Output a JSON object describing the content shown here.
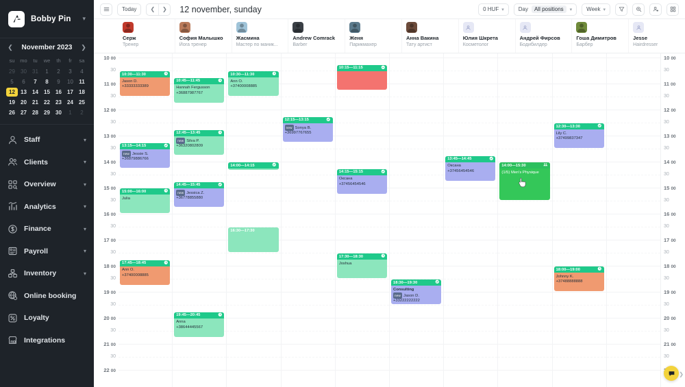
{
  "sidebar": {
    "brand": {
      "name": "Bobby Pin",
      "logo_icon": "bobbypin-logo-icon",
      "caret_icon": "chevron-down-icon"
    },
    "calendar": {
      "title": "November 2023",
      "prev_icon": "chevron-left-icon",
      "next_icon": "chevron-right-icon",
      "dow": [
        "su",
        "mo",
        "tu",
        "we",
        "th",
        "fr",
        "sa"
      ],
      "selected_day": "12",
      "weeks": [
        [
          {
            "d": "29",
            "t": "muted"
          },
          {
            "d": "30",
            "t": "muted"
          },
          {
            "d": "31",
            "t": "muted"
          },
          {
            "d": "1",
            "t": "dim"
          },
          {
            "d": "2",
            "t": "dim"
          },
          {
            "d": "3",
            "t": "dim"
          },
          {
            "d": "4",
            "t": "dim"
          }
        ],
        [
          {
            "d": "5",
            "t": "dim"
          },
          {
            "d": "6",
            "t": "dim"
          },
          {
            "d": "7",
            "t": "on"
          },
          {
            "d": "8",
            "t": "on"
          },
          {
            "d": "9",
            "t": "dim"
          },
          {
            "d": "10",
            "t": "dim"
          },
          {
            "d": "11",
            "t": "on"
          }
        ],
        [
          {
            "d": "12",
            "t": "sel"
          },
          {
            "d": "13",
            "t": "on"
          },
          {
            "d": "14",
            "t": "on"
          },
          {
            "d": "15",
            "t": "on"
          },
          {
            "d": "16",
            "t": "on"
          },
          {
            "d": "17",
            "t": "on"
          },
          {
            "d": "18",
            "t": "on"
          }
        ],
        [
          {
            "d": "19",
            "t": "on"
          },
          {
            "d": "20",
            "t": "on"
          },
          {
            "d": "21",
            "t": "on"
          },
          {
            "d": "22",
            "t": "on"
          },
          {
            "d": "23",
            "t": "on"
          },
          {
            "d": "24",
            "t": "on"
          },
          {
            "d": "25",
            "t": "on"
          }
        ],
        [
          {
            "d": "26",
            "t": "on"
          },
          {
            "d": "27",
            "t": "on"
          },
          {
            "d": "28",
            "t": "on"
          },
          {
            "d": "29",
            "t": "on"
          },
          {
            "d": "30",
            "t": "on"
          },
          {
            "d": "1",
            "t": "muted"
          },
          {
            "d": "2",
            "t": "muted"
          }
        ]
      ]
    },
    "items": [
      {
        "label": "Staff",
        "icon": "user-icon",
        "expandable": true
      },
      {
        "label": "Clients",
        "icon": "users-icon",
        "expandable": true
      },
      {
        "label": "Overview",
        "icon": "grid-search-icon",
        "expandable": true
      },
      {
        "label": "Analytics",
        "icon": "bar-chart-icon",
        "expandable": true
      },
      {
        "label": "Finance",
        "icon": "dollar-coin-icon",
        "expandable": true
      },
      {
        "label": "Payroll",
        "icon": "payroll-icon",
        "expandable": true
      },
      {
        "label": "Inventory",
        "icon": "box-icon",
        "expandable": true
      },
      {
        "label": "Online booking",
        "icon": "globe-gear-icon",
        "expandable": false
      },
      {
        "label": "Loyalty",
        "icon": "percent-box-icon",
        "expandable": false
      },
      {
        "label": "Integrations",
        "icon": "storefront-icon",
        "expandable": false
      }
    ]
  },
  "toolbar": {
    "menu_icon": "hamburger-icon",
    "today_label": "Today",
    "prev_icon": "chevron-left-icon",
    "next_icon": "chevron-right-icon",
    "date_title": "12 november, sunday",
    "currency_label": "0 HUF",
    "view_label": "Day",
    "positions_label": "All positions",
    "range_label": "Week",
    "filter_icon": "funnel-icon",
    "search_icon": "search-plus-icon",
    "add_client_icon": "user-add-icon",
    "apps_icon": "apps-grid-icon"
  },
  "staff": [
    {
      "name": "Серж",
      "role": "Тренер",
      "avatar": "photo",
      "color": "#c0392b"
    },
    {
      "name": "София Малышко",
      "role": "Йога тренер",
      "avatar": "photo",
      "color": "#b97a5a"
    },
    {
      "name": "Жасмина",
      "role": "Мастер по маник...",
      "avatar": "photo",
      "color": "#9fc3d8"
    },
    {
      "name": "Andrew Comrack",
      "role": "Barber",
      "avatar": "photo",
      "color": "#3a3f45"
    },
    {
      "name": "Женя",
      "role": "Парикмахер",
      "avatar": "photo",
      "color": "#5b7a8c"
    },
    {
      "name": "Анна Вакина",
      "role": "Тату артист",
      "avatar": "photo",
      "color": "#6b4a3a"
    },
    {
      "name": "Юлия Шкрета",
      "role": "Косметолог",
      "avatar": "placeholder",
      "color": "#e6e8f5"
    },
    {
      "name": "Андрей Фирсов",
      "role": "Бодибилдер",
      "avatar": "placeholder",
      "color": "#e6e8f5"
    },
    {
      "name": "Гоша Димитров",
      "role": "Барбер",
      "avatar": "photo",
      "color": "#6f8a3a"
    },
    {
      "name": "Jesse",
      "role": "Hairdresser",
      "avatar": "placeholder",
      "color": "#e6e8f5"
    }
  ],
  "time_axis": {
    "hours": [
      "10",
      "11",
      "12",
      "13",
      "14",
      "15",
      "16",
      "17",
      "18",
      "19",
      "20",
      "21",
      "22"
    ],
    "half_label": "30",
    "hour_suffix": "00"
  },
  "events": [
    {
      "col": 0,
      "time": "10:30—11:30",
      "title": "Jason D.",
      "phone": "+33333333389",
      "badge": "",
      "start": 10.5,
      "end": 11.5,
      "head": "#1fc98a",
      "body": "#f09a70",
      "status_icon": "clock-icon"
    },
    {
      "col": 0,
      "time": "13:15—14:15",
      "title": "Jessie S.",
      "phone": "+36879886766",
      "badge": "new",
      "start": 13.25,
      "end": 14.25,
      "head": "#1fc98a",
      "body": "#a9aef0",
      "status_icon": "check-icon"
    },
    {
      "col": 0,
      "time": "15:00—16:00",
      "title": "Julia",
      "phone": "",
      "badge": "",
      "start": 15.0,
      "end": 16.0,
      "head": "#1fc98a",
      "body": "#8ce6bd",
      "status_icon": "clock-icon"
    },
    {
      "col": 0,
      "time": "17:45—18:45",
      "title": "Ann O.",
      "phone": "+37400008885",
      "badge": "",
      "start": 17.75,
      "end": 18.75,
      "head": "#1fc98a",
      "body": "#f09a70",
      "status_icon": "clock-icon"
    },
    {
      "col": 1,
      "time": "10:45—11:45",
      "title": "Hannah Fergusson",
      "phone": "+36887987767",
      "badge": "",
      "start": 10.75,
      "end": 11.75,
      "head": "#1fc98a",
      "body": "#8ce6bd",
      "status_icon": "clock-icon"
    },
    {
      "col": 1,
      "time": "12:45—13:45",
      "title": "Silva P.",
      "phone": "+36320802809",
      "badge": "new",
      "start": 12.75,
      "end": 13.75,
      "head": "#1fc98a",
      "body": "#8ce6bd",
      "status_icon": "clock-icon"
    },
    {
      "col": 1,
      "time": "14:45—15:45",
      "title": "Jessica Z.",
      "phone": "+36778855880",
      "badge": "new",
      "start": 14.75,
      "end": 15.75,
      "head": "#1fc98a",
      "body": "#a9aef0",
      "status_icon": "check-icon"
    },
    {
      "col": 1,
      "time": "19:45—20:45",
      "title": "Anna",
      "phone": "+38644445567",
      "badge": "",
      "start": 19.75,
      "end": 20.75,
      "head": "#1fc98a",
      "body": "#8ce6bd",
      "status_icon": "clock-icon"
    },
    {
      "col": 2,
      "time": "10:30—11:30",
      "title": "Ann O.",
      "phone": "+37400008885",
      "badge": "",
      "start": 10.5,
      "end": 11.5,
      "head": "#1fc98a",
      "body": "#8ce6bd",
      "status_icon": "clock-icon"
    },
    {
      "col": 2,
      "time": "14:00—14:15",
      "title": "",
      "phone": "",
      "badge": "",
      "start": 14.0,
      "end": 14.25,
      "head": "#1fc98a",
      "body": "#8ce6bd",
      "status_icon": "check-icon"
    },
    {
      "col": 2,
      "time": "16:30—17:30",
      "title": "",
      "phone": "",
      "badge": "",
      "start": 16.5,
      "end": 17.5,
      "head": "#8ce6bd",
      "body": "#8ce6bd",
      "status_icon": ""
    },
    {
      "col": 3,
      "time": "12:15—13:15",
      "title": "Sonya B.",
      "phone": "+36997767655",
      "badge": "new",
      "start": 12.25,
      "end": 13.25,
      "head": "#1fc98a",
      "body": "#a9aef0",
      "status_icon": "check-icon"
    },
    {
      "col": 4,
      "time": "10:15—11:15",
      "title": "",
      "phone": "",
      "badge": "",
      "start": 10.25,
      "end": 11.25,
      "head": "#1fc98a",
      "body": "#f4736f",
      "status_icon": "minus-icon"
    },
    {
      "col": 4,
      "time": "14:15—15:15",
      "title": "Оксана",
      "phone": "+37456454546",
      "badge": "",
      "start": 14.25,
      "end": 15.25,
      "head": "#1fc98a",
      "body": "#a9aef0",
      "status_icon": "check-icon"
    },
    {
      "col": 4,
      "time": "17:30—18:30",
      "title": "Joshua",
      "phone": "",
      "badge": "",
      "start": 17.5,
      "end": 18.5,
      "head": "#1fc98a",
      "body": "#8ce6bd",
      "status_icon": "clock-icon"
    },
    {
      "col": 5,
      "time": "18:30—19:30",
      "title": "Consulting",
      "subtitle": "Jason D.",
      "phone": "+33222222222",
      "badge": "new",
      "start": 18.5,
      "end": 19.5,
      "head": "#1fc98a",
      "body": "#a9aef0",
      "status_icon": "check-icon"
    },
    {
      "col": 6,
      "time": "13:45—14:45",
      "title": "Оксана",
      "phone": "+37456454546",
      "badge": "",
      "start": 13.75,
      "end": 14.75,
      "head": "#1fc98a",
      "body": "#a9aef0",
      "status_icon": "check-icon"
    },
    {
      "col": 7,
      "time": "14:00—15:30",
      "title": "(1/5) Men's Physique",
      "phone": "",
      "badge": "",
      "start": 14.0,
      "end": 15.5,
      "head": "#2cbf5e",
      "body": "#34c759",
      "status_icon": "group-icon"
    },
    {
      "col": 8,
      "time": "12:30—13:30",
      "title": "Lily C.",
      "phone": "+37499837347",
      "badge": "",
      "start": 12.5,
      "end": 13.5,
      "head": "#1fc98a",
      "body": "#a9aef0",
      "status_icon": "check-icon"
    },
    {
      "col": 8,
      "time": "18:00—19:00",
      "title": "Johnny K.",
      "phone": "+37488888888",
      "badge": "",
      "start": 18.0,
      "end": 19.0,
      "head": "#1fc98a",
      "body": "#f09a70",
      "status_icon": "clock-icon"
    }
  ],
  "fab": {
    "icon": "chat-icon",
    "color": "#f3d33c"
  },
  "edge_arrow_icon": "chevron-right-icon"
}
